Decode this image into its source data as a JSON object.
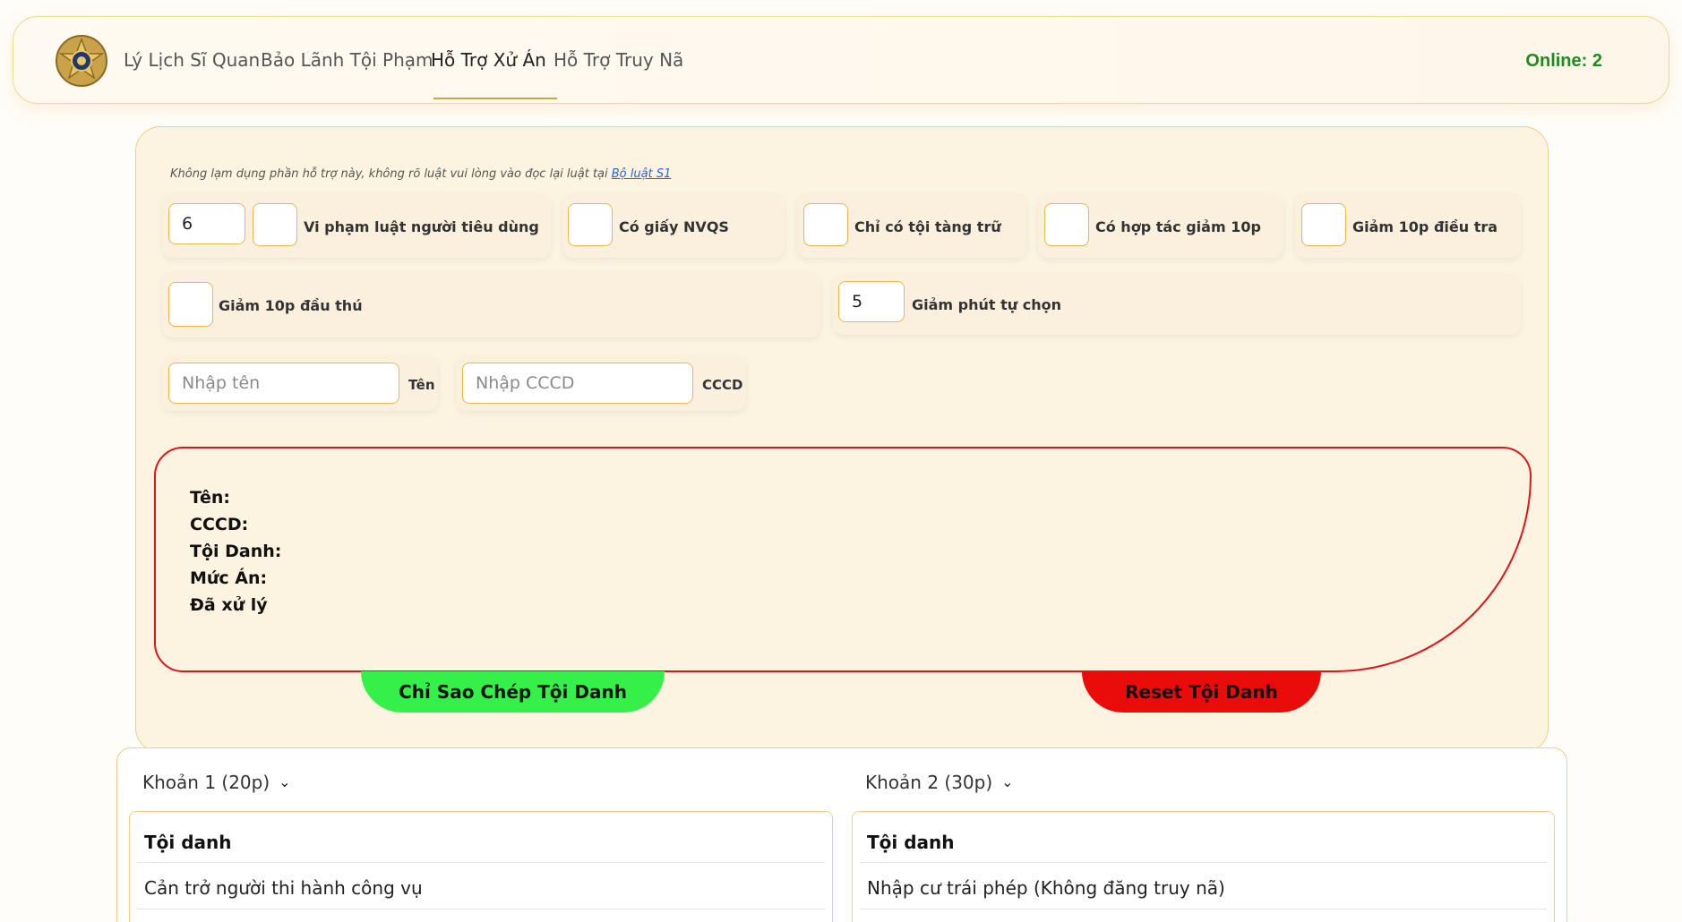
{
  "nav": {
    "links": [
      "Lý Lịch Sĩ Quan",
      "Bảo Lãnh Tội Phạm",
      "Hỗ Trợ Xử Án",
      "Hỗ Trợ Truy Nã"
    ],
    "active": "Hỗ Trợ Xử Án",
    "online_label": "Online: 2"
  },
  "note": {
    "text": "Không lạm dụng phần hỗ trợ này, không rõ luật vui lòng vào đọc lại luật tại ",
    "link": "Bộ luật S1"
  },
  "options": {
    "consumer_value": "6",
    "consumer_label": "Vi phạm luật người tiêu dùng",
    "nvqs_label": "Có giấy NVQS",
    "possession_label": "Chỉ có tội tàng trữ",
    "cooperate_label": "Có hợp tác giảm 10p",
    "investigation_label": "Giảm 10p điều tra",
    "surrender_label": "Giảm 10p đầu thú",
    "custom_value": "5",
    "custom_label": "Giảm phút tự chọn"
  },
  "inputs": {
    "name_placeholder": "Nhập tên",
    "name_label": "Tên",
    "cccd_placeholder": "Nhập CCCD",
    "cccd_label": "CCCD"
  },
  "result": {
    "name": "Tên:",
    "cccd": "CCCD:",
    "charges": "Tội Danh:",
    "sentence": "Mức Án:",
    "handled": "Đã xử lý"
  },
  "buttons": {
    "copy": "Chỉ Sao Chép Tội Danh",
    "reset": "Reset Tội Danh"
  },
  "sections": [
    {
      "title": "Khoản 1 (20p)",
      "header": "Tội danh",
      "rows": [
        "Cản trở người thi hành công vụ"
      ]
    },
    {
      "title": "Khoản 2 (30p)",
      "header": "Tội danh",
      "rows": [
        "Nhập cư trái phép (Không đăng truy nã)"
      ]
    }
  ],
  "colors": {
    "accent_border": "#f2cf86",
    "online_green": "#1f8a1f",
    "copy_button": "#36f04a",
    "reset_button": "#ea0b0b",
    "result_border": "#e0141c"
  }
}
